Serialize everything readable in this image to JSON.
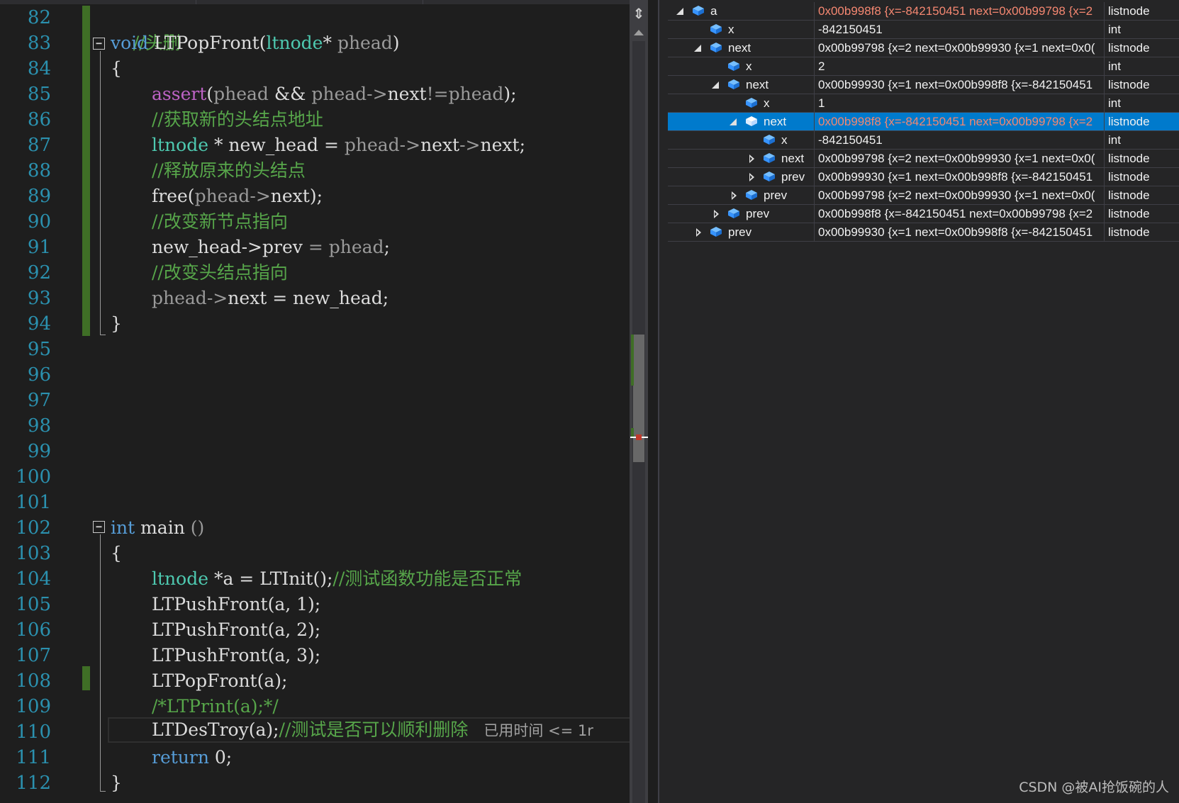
{
  "editor": {
    "line_numbers": [
      "82",
      "83",
      "84",
      "85",
      "86",
      "87",
      "88",
      "89",
      "90",
      "91",
      "92",
      "93",
      "94",
      "95",
      "96",
      "97",
      "98",
      "99",
      "100",
      "101",
      "102",
      "103",
      "104",
      "105",
      "106",
      "107",
      "108",
      "109",
      "110",
      "111",
      "112"
    ],
    "code": {
      "l82": {
        "comment": "//头删"
      },
      "l83": {
        "kw": "void",
        "fn": " LTPopFront(",
        "type": "ltnode",
        "star": "* ",
        "param": "phead",
        "close": ")"
      },
      "l84": {
        "brace": "{"
      },
      "l85": {
        "macro": "assert",
        "open": "(",
        "p1": "phead",
        "and": " && ",
        "p2": "phead",
        "arrow": "->",
        "m": "next",
        "neq": "!=",
        "p3": "phead",
        "end": ");"
      },
      "l86": {
        "comment": "//获取新的头结点地址"
      },
      "l87": {
        "type": "ltnode",
        "mid": " * new_head = ",
        "p": "phead",
        "a1": "->",
        "m1": "next",
        "a2": "->",
        "m2": "next",
        "end": ";"
      },
      "l88": {
        "comment": "//释放原来的头结点"
      },
      "l89": {
        "fn": "free",
        "open": "(",
        "p": "phead",
        "arrow": "->",
        "m": "next",
        "end": ");"
      },
      "l90": {
        "comment": "//改变新节点指向"
      },
      "l91": {
        "lhs": "new_head->prev ",
        "eq": "= ",
        "p": "phead",
        "end": ";"
      },
      "l92": {
        "comment": "//改变头结点指向"
      },
      "l93": {
        "p": "phead",
        "arrow": "->",
        "rest": "next = new_head;"
      },
      "l94": {
        "brace": "}"
      },
      "l102": {
        "kw": "int",
        "rest": " main ",
        "paren": "()"
      },
      "l103": {
        "brace": "{"
      },
      "l104": {
        "type": "ltnode",
        "rest": " *a = LTInit",
        "paren": "();",
        "comment": "//测试函数功能是否正常"
      },
      "l105": {
        "text": "LTPushFront(a, 1);"
      },
      "l106": {
        "text": "LTPushFront(a, 2);"
      },
      "l107": {
        "text": "LTPushFront(a, 3);"
      },
      "l108": {
        "text": "LTPopFront(a);"
      },
      "l109": {
        "comment": "/*LTPrint(a);*/"
      },
      "l110": {
        "text": "LTDesTroy(a);",
        "comment": "//测试是否可以顺利删除",
        "elapsed": "已用时间 <= 1r"
      },
      "l111": {
        "kw": "return",
        "rest": " 0;"
      },
      "l112": {
        "brace": "}"
      }
    }
  },
  "watch": {
    "rows": [
      {
        "name": "a",
        "value": "0x00b998f8 {x=-842150451 next=0x00b99798 {x=2",
        "type": "listnode",
        "changed": true
      },
      {
        "name": "x",
        "value": "-842150451",
        "type": "int"
      },
      {
        "name": "next",
        "value": "0x00b99798 {x=2 next=0x00b99930 {x=1 next=0x0(",
        "type": "listnode"
      },
      {
        "name": "x",
        "value": "2",
        "type": "int"
      },
      {
        "name": "next",
        "value": "0x00b99930 {x=1 next=0x00b998f8 {x=-842150451",
        "type": "listnode"
      },
      {
        "name": "x",
        "value": "1",
        "type": "int"
      },
      {
        "name": "next",
        "value": "0x00b998f8 {x=-842150451 next=0x00b99798 {x=2",
        "type": "listnode",
        "changed": true,
        "selected": true
      },
      {
        "name": "x",
        "value": "-842150451",
        "type": "int"
      },
      {
        "name": "next",
        "value": "0x00b99798 {x=2 next=0x00b99930 {x=1 next=0x0(",
        "type": "listnode"
      },
      {
        "name": "prev",
        "value": "0x00b99930 {x=1 next=0x00b998f8 {x=-842150451",
        "type": "listnode"
      },
      {
        "name": "prev",
        "value": "0x00b99798 {x=2 next=0x00b99930 {x=1 next=0x0(",
        "type": "listnode"
      },
      {
        "name": "prev",
        "value": "0x00b998f8 {x=-842150451 next=0x00b99798 {x=2",
        "type": "listnode"
      },
      {
        "name": "prev",
        "value": "0x00b99930 {x=1 next=0x00b998f8 {x=-842150451",
        "type": "listnode"
      }
    ]
  },
  "watermark": "CSDN @被AI抢饭碗的人",
  "colors": {
    "comment": "#57a64a",
    "keyword": "#569cd6",
    "type": "#4ec9b0",
    "selection": "#007acc",
    "changed_value": "#f48771"
  }
}
